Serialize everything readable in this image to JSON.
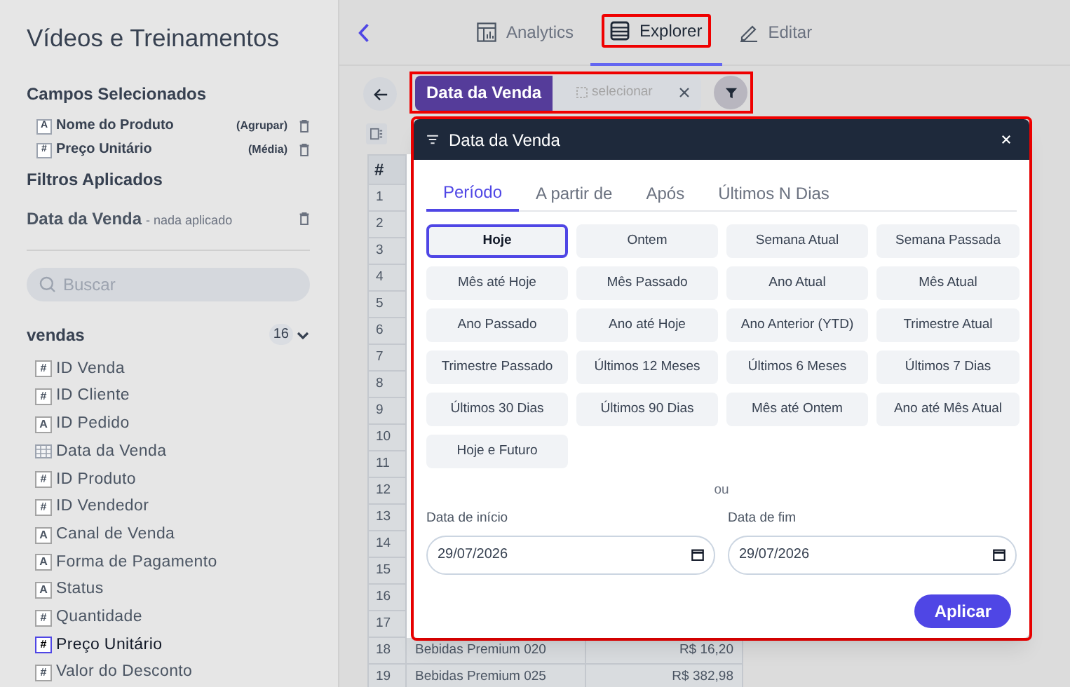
{
  "sidebar": {
    "title": "Vídeos e Treinamentos",
    "selected_heading": "Campos Selecionados",
    "selected_fields": [
      {
        "glyph": "A",
        "label": "Nome do Produto",
        "aggregation": "(Agrupar)"
      },
      {
        "glyph": "#",
        "label": "Preço Unitário",
        "aggregation": "(Média)"
      }
    ],
    "filters_heading": "Filtros Aplicados",
    "filters": [
      {
        "label": "Data da Venda",
        "status": "- nada aplicado"
      }
    ],
    "search": {
      "placeholder": "Buscar"
    },
    "group": {
      "name": "vendas",
      "count": "16",
      "expanded": true
    },
    "fields": [
      {
        "kind": "type",
        "glyph": "#",
        "label": "ID Venda",
        "selected": false
      },
      {
        "kind": "type",
        "glyph": "#",
        "label": "ID Cliente",
        "selected": false
      },
      {
        "kind": "type",
        "glyph": "A",
        "label": "ID Pedido",
        "selected": false
      },
      {
        "kind": "date",
        "label": "Data da Venda",
        "selected": false
      },
      {
        "kind": "type",
        "glyph": "#",
        "label": "ID Produto",
        "selected": false
      },
      {
        "kind": "type",
        "glyph": "#",
        "label": "ID Vendedor",
        "selected": false
      },
      {
        "kind": "type",
        "glyph": "A",
        "label": "Canal de Venda",
        "selected": false
      },
      {
        "kind": "type",
        "glyph": "A",
        "label": "Forma de Pagamento",
        "selected": false
      },
      {
        "kind": "type",
        "glyph": "A",
        "label": "Status",
        "selected": false
      },
      {
        "kind": "type",
        "glyph": "#",
        "label": "Quantidade",
        "selected": false
      },
      {
        "kind": "type",
        "glyph": "#",
        "label": "Preço Unitário",
        "selected": true
      },
      {
        "kind": "type",
        "glyph": "#",
        "label": "Valor do Desconto",
        "selected": false
      }
    ]
  },
  "tabs": [
    {
      "label": "Analytics",
      "selected": false
    },
    {
      "label": "Explorer",
      "selected": true
    },
    {
      "label": "Editar",
      "selected": false
    }
  ],
  "filter_bar": {
    "chip": "Data da Venda",
    "placeholder": "selecionar"
  },
  "table": {
    "header": "#",
    "rows": [
      {
        "index": "1"
      },
      {
        "index": "2"
      },
      {
        "index": "3"
      },
      {
        "index": "4"
      },
      {
        "index": "5"
      },
      {
        "index": "6"
      },
      {
        "index": "7"
      },
      {
        "index": "8"
      },
      {
        "index": "9"
      },
      {
        "index": "10"
      },
      {
        "index": "11"
      },
      {
        "index": "12"
      },
      {
        "index": "13"
      },
      {
        "index": "14"
      },
      {
        "index": "15"
      },
      {
        "index": "16"
      },
      {
        "index": "17"
      },
      {
        "index": "18",
        "cells": [
          "Bebidas Premium 020",
          "R$ 16,20"
        ]
      },
      {
        "index": "19",
        "cells": [
          "Bebidas Premium 025",
          "R$ 382,98"
        ]
      }
    ]
  },
  "popover": {
    "title": "Data da Venda",
    "tabs": [
      {
        "label": "Período",
        "selected": true
      },
      {
        "label": "A partir de",
        "selected": false
      },
      {
        "label": "Após",
        "selected": false
      },
      {
        "label": "Últimos N Dias",
        "selected": false
      }
    ],
    "presets": [
      {
        "label": "Hoje",
        "selected": true
      },
      {
        "label": "Ontem",
        "selected": false
      },
      {
        "label": "Semana Atual",
        "selected": false
      },
      {
        "label": "Semana Passada",
        "selected": false
      },
      {
        "label": "Mês até Hoje",
        "selected": false
      },
      {
        "label": "Mês Passado",
        "selected": false
      },
      {
        "label": "Ano Atual",
        "selected": false
      },
      {
        "label": "Mês Atual",
        "selected": false
      },
      {
        "label": "Ano Passado",
        "selected": false
      },
      {
        "label": "Ano até Hoje",
        "selected": false
      },
      {
        "label": "Ano Anterior (YTD)",
        "selected": false
      },
      {
        "label": "Trimestre Atual",
        "selected": false
      },
      {
        "label": "Trimestre Passado",
        "selected": false
      },
      {
        "label": "Últimos 12 Meses",
        "selected": false
      },
      {
        "label": "Últimos 6 Meses",
        "selected": false
      },
      {
        "label": "Últimos 7 Dias",
        "selected": false
      },
      {
        "label": "Últimos 30 Dias",
        "selected": false
      },
      {
        "label": "Últimos 90 Dias",
        "selected": false
      },
      {
        "label": "Mês até Ontem",
        "selected": false
      },
      {
        "label": "Ano até Mês Atual",
        "selected": false
      },
      {
        "label": "Hoje e Futuro",
        "selected": false
      }
    ],
    "separator": "ou",
    "start": {
      "label": "Data de início",
      "value": "29/07/2026"
    },
    "end": {
      "label": "Data de fim",
      "value": "29/07/2026"
    },
    "apply": "Aplicar"
  }
}
